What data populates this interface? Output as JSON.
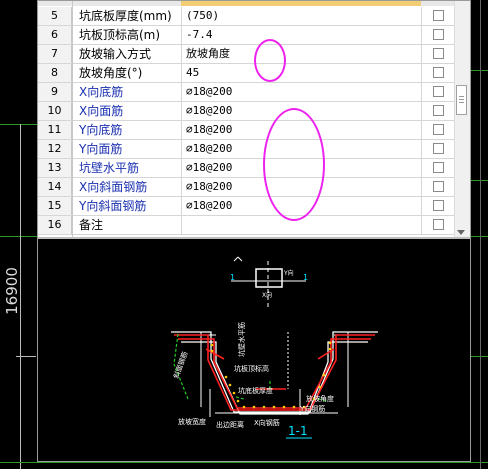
{
  "dimension_label": "16900",
  "rows": [
    {
      "num": "5",
      "name": "坑底板厚度(mm)",
      "value": "(750)",
      "style": "black"
    },
    {
      "num": "6",
      "name": "坑板顶标高(m)",
      "value": "-7.4",
      "style": "black"
    },
    {
      "num": "7",
      "name": "放坡输入方式",
      "value": "放坡角度",
      "style": "black"
    },
    {
      "num": "8",
      "name": "放坡角度(°)",
      "value": "45",
      "style": "black"
    },
    {
      "num": "9",
      "name": "X向底筋",
      "value": "⌀18@200",
      "style": "blue"
    },
    {
      "num": "10",
      "name": "X向面筋",
      "value": "⌀18@200",
      "style": "blue"
    },
    {
      "num": "11",
      "name": "Y向底筋",
      "value": "⌀18@200",
      "style": "blue"
    },
    {
      "num": "12",
      "name": "Y向面筋",
      "value": "⌀18@200",
      "style": "blue"
    },
    {
      "num": "13",
      "name": "坑壁水平筋",
      "value": "⌀18@200",
      "style": "blue"
    },
    {
      "num": "14",
      "name": "X向斜面钢筋",
      "value": "⌀18@200",
      "style": "blue"
    },
    {
      "num": "15",
      "name": "Y向斜面钢筋",
      "value": "⌀18@200",
      "style": "blue"
    },
    {
      "num": "16",
      "name": "备注",
      "value": "",
      "style": "black"
    }
  ],
  "diagram": {
    "plan_mark": "1",
    "plan_mark_right": "1",
    "x_axis": "X向",
    "y_axis": "Y向",
    "labels": {
      "wall_bar": "坑壁水平筋",
      "top_elev": "坑板顶标高",
      "slope_bar": "斜面钢筋",
      "bottom_thick": "坑底板厚度",
      "slope_angle": "放坡角度",
      "y_bar": "Y向钢筋",
      "slope_width": "放坡宽度",
      "edge_dist": "出边距离",
      "x_bar": "X向钢筋"
    },
    "section_title": "1-1"
  },
  "colors": {
    "annotation": "#ee22ee",
    "rebar": "#ff2020",
    "cad_line": "#ffffff",
    "cad_green": "#22cc22",
    "section_title": "#00e5ff"
  }
}
